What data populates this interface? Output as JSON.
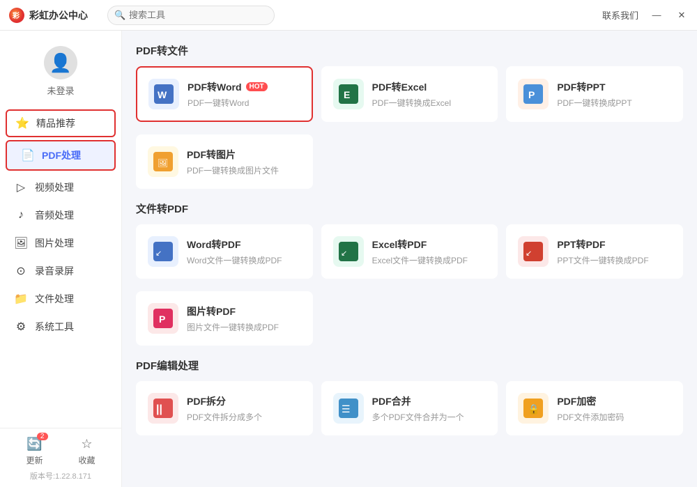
{
  "app": {
    "title": "彩虹办公中心",
    "contact": "联系我们",
    "minimize": "—",
    "close": "✕"
  },
  "search": {
    "placeholder": "搜索工具"
  },
  "user": {
    "label": "未登录"
  },
  "sidebar": {
    "items": [
      {
        "id": "featured",
        "label": "精品推荐",
        "icon": "⭐"
      },
      {
        "id": "pdf",
        "label": "PDF处理",
        "icon": "📄",
        "active": true
      },
      {
        "id": "video",
        "label": "视频处理",
        "icon": "▶"
      },
      {
        "id": "audio",
        "label": "音频处理",
        "icon": "♪"
      },
      {
        "id": "image",
        "label": "图片处理",
        "icon": "🖼"
      },
      {
        "id": "record",
        "label": "录音录屏",
        "icon": "⊙"
      },
      {
        "id": "file",
        "label": "文件处理",
        "icon": "📁"
      },
      {
        "id": "system",
        "label": "系统工具",
        "icon": "⚙"
      }
    ]
  },
  "bottom": {
    "update_label": "更新",
    "update_badge": "2",
    "favorite_label": "收藏",
    "version": "版本号:1.22.8.171"
  },
  "sections": {
    "pdf_to_file": {
      "title": "PDF转文件",
      "tools": [
        {
          "id": "pdf-word",
          "title": "PDF转Word",
          "hot": true,
          "desc": "PDF一键转Word",
          "icon_text": "W",
          "icon_class": "icon-word",
          "highlighted": true
        },
        {
          "id": "pdf-excel",
          "title": "PDF转Excel",
          "hot": false,
          "desc": "PDF一键转换成Excel",
          "icon_text": "E",
          "icon_class": "icon-excel",
          "highlighted": false
        },
        {
          "id": "pdf-ppt",
          "title": "PDF转PPT",
          "hot": false,
          "desc": "PDF一键转换成PPT",
          "icon_text": "P",
          "icon_class": "icon-ppt",
          "highlighted": false
        }
      ],
      "tools2": [
        {
          "id": "pdf-img",
          "title": "PDF转图片",
          "hot": false,
          "desc": "PDF一键转换成图片文件",
          "icon_text": "🖼",
          "icon_class": "icon-pdf-img",
          "highlighted": false
        }
      ]
    },
    "file_to_pdf": {
      "title": "文件转PDF",
      "tools": [
        {
          "id": "word-pdf",
          "title": "Word转PDF",
          "desc": "Word文件一键转换成PDF",
          "icon_text": "↙",
          "icon_class": "icon-word"
        },
        {
          "id": "excel-pdf",
          "title": "Excel转PDF",
          "desc": "Excel文件一键转换成PDF",
          "icon_text": "↙",
          "icon_class": "icon-excel"
        },
        {
          "id": "ppt-pdf",
          "title": "PPT转PDF",
          "desc": "PPT文件一键转换成PDF",
          "icon_text": "↙",
          "icon_class": "icon-pdf-ppt"
        }
      ],
      "tools2": [
        {
          "id": "img-pdf",
          "title": "图片转PDF",
          "desc": "图片文件一键转换成PDF",
          "icon_text": "P",
          "icon_class": "icon-split"
        }
      ]
    },
    "pdf_edit": {
      "title": "PDF编辑处理",
      "tools": [
        {
          "id": "pdf-split",
          "title": "PDF拆分",
          "desc": "PDF文件拆分成多个",
          "icon_text": "||",
          "icon_class": "icon-split"
        },
        {
          "id": "pdf-merge",
          "title": "PDF合并",
          "desc": "多个PDF文件合并为一个",
          "icon_text": "☰",
          "icon_class": "icon-merge"
        },
        {
          "id": "pdf-encrypt",
          "title": "PDF加密",
          "desc": "PDF文件添加密码",
          "icon_text": "🔒",
          "icon_class": "icon-encrypt"
        }
      ]
    }
  }
}
